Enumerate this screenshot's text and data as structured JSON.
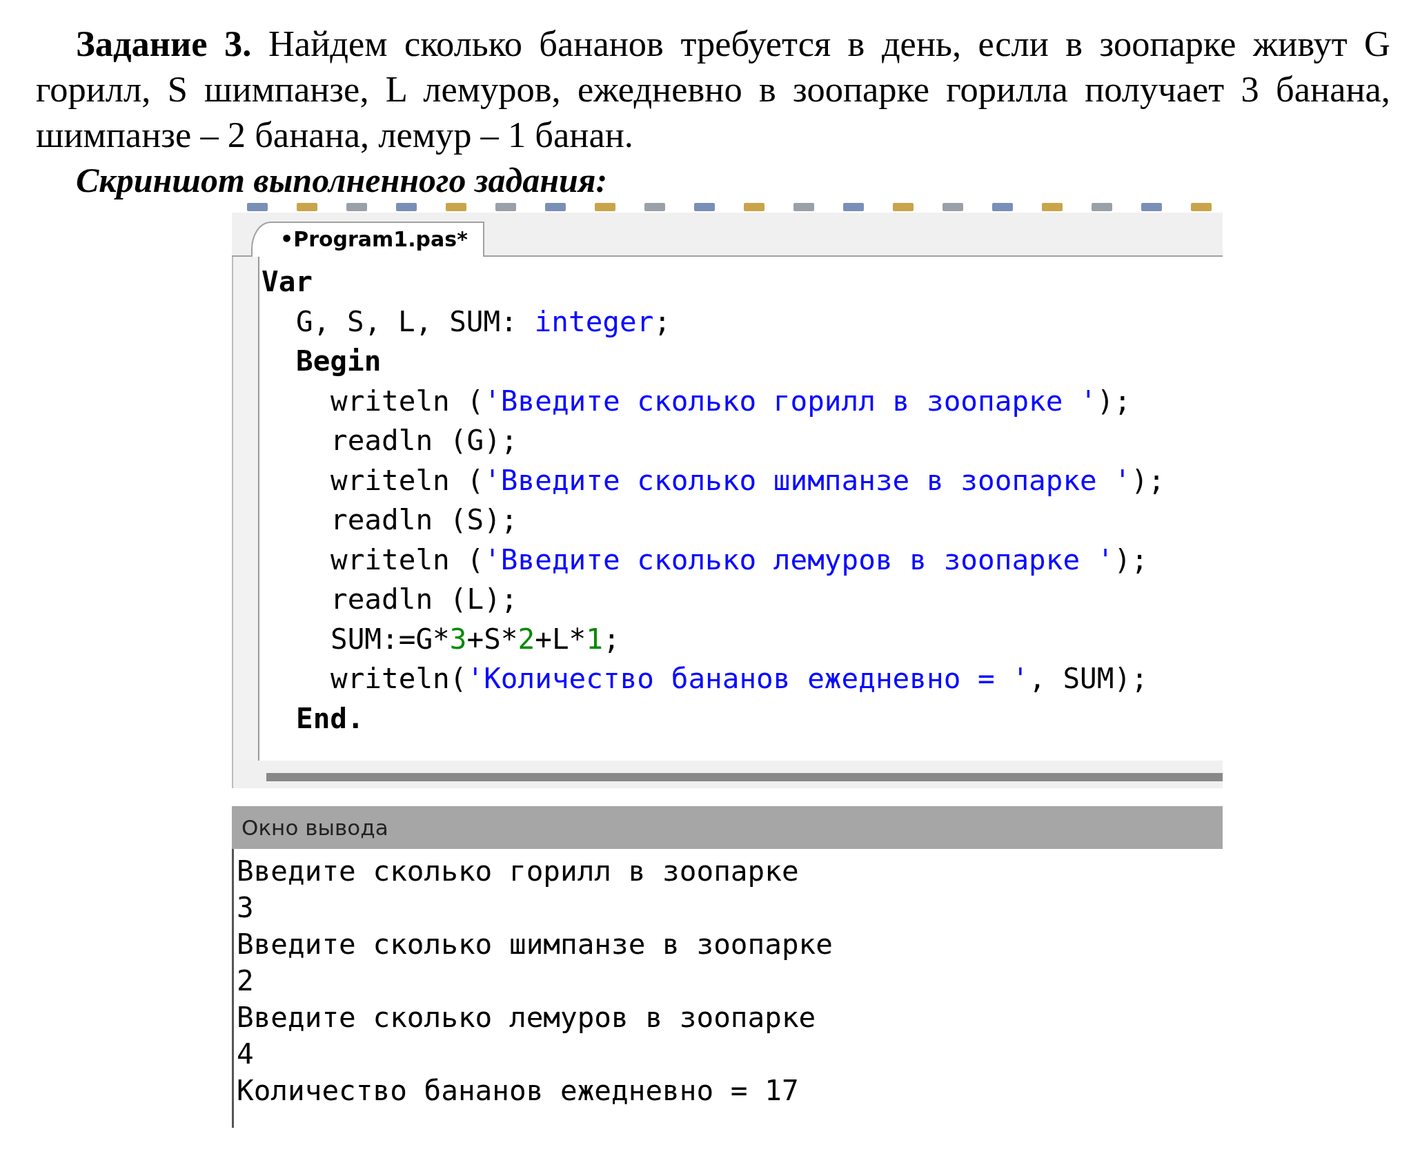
{
  "task": {
    "text": "**Задание 3.** Найдем сколько бананов требуется в день, если в зоопарке живут G горилл, S шимпанзе, L лемуров, ежедневно в зоопарке горилла получает 3 банана, шимпанзе – 2 банана, лемур – 1 банан."
  },
  "caption": "Скриншот выполненного задания:",
  "ide": {
    "tab": {
      "label": "•Program1.pas*",
      "selected": true
    },
    "code": [
      {
        "tokens": [
          {
            "kind": "keyword",
            "text": "Var"
          }
        ],
        "children": [
          {
            "tokens": [
              {
                "kind": "plain",
                "text": "G, S, L, SUM: "
              },
              {
                "kind": "type",
                "text": "integer"
              },
              {
                "kind": "plain",
                "text": ";"
              }
            ]
          },
          {
            "tokens": [
              {
                "kind": "keyword",
                "text": "Begin"
              }
            ],
            "children": [
              {
                "tokens": [
                  {
                    "kind": "plain",
                    "text": "writeln ("
                  },
                  {
                    "kind": "string",
                    "text": "'Введите сколько горилл в зоопарке '"
                  },
                  {
                    "kind": "plain",
                    "text": ");"
                  }
                ]
              },
              {
                "tokens": [
                  {
                    "kind": "plain",
                    "text": "readln (G);"
                  }
                ]
              },
              {
                "tokens": [
                  {
                    "kind": "plain",
                    "text": "writeln ("
                  },
                  {
                    "kind": "string",
                    "text": "'Введите сколько шимпанзе в зоопарке '"
                  },
                  {
                    "kind": "plain",
                    "text": ");"
                  }
                ]
              },
              {
                "tokens": [
                  {
                    "kind": "plain",
                    "text": "readln (S);"
                  }
                ]
              },
              {
                "tokens": [
                  {
                    "kind": "plain",
                    "text": "writeln ("
                  },
                  {
                    "kind": "string",
                    "text": "'Введите сколько лемуров в зоопарке '"
                  },
                  {
                    "kind": "plain",
                    "text": ");"
                  }
                ]
              },
              {
                "tokens": [
                  {
                    "kind": "plain",
                    "text": "readln (L);"
                  }
                ]
              },
              {
                "tokens": [
                  {
                    "kind": "plain",
                    "text": "SUM:=G*"
                  },
                  {
                    "kind": "number",
                    "text": "3"
                  },
                  {
                    "kind": "plain",
                    "text": "+S*"
                  },
                  {
                    "kind": "number",
                    "text": "2"
                  },
                  {
                    "kind": "plain",
                    "text": "+L*"
                  },
                  {
                    "kind": "number",
                    "text": "1"
                  },
                  {
                    "kind": "plain",
                    "text": ";"
                  }
                ]
              },
              {
                "tokens": [
                  {
                    "kind": "plain",
                    "text": "writeln("
                  },
                  {
                    "kind": "string",
                    "text": "'Количество бананов ежедневно = '"
                  },
                  {
                    "kind": "plain",
                    "text": ", SUM);"
                  }
                ]
              }
            ]
          },
          {
            "tokens": [
              {
                "kind": "keyword",
                "text": "End."
              }
            ]
          }
        ]
      }
    ],
    "output": {
      "title": "Окно вывода",
      "lines": [
        "Введите сколько горилл в зоопарке",
        "3",
        "Введите сколько шимпанзе в зоопарке",
        "2",
        "Введите сколько лемуров в зоопарке",
        "4",
        "Количество бананов ежедневно = 17"
      ]
    }
  }
}
